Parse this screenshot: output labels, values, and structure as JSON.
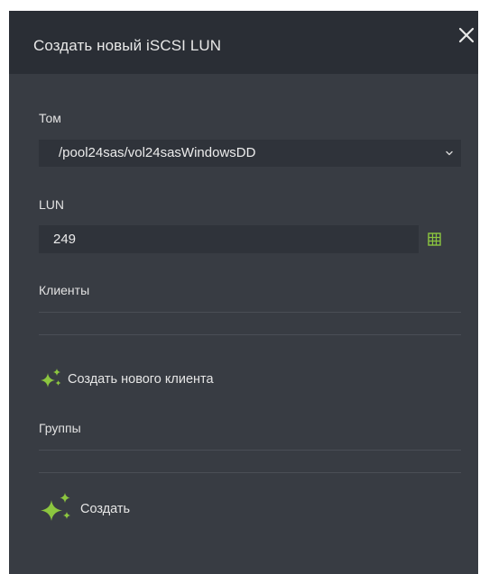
{
  "dialog": {
    "title": "Создать новый iSCSI LUN",
    "close_icon": "close-icon"
  },
  "form": {
    "volume": {
      "label": "Том",
      "value": "/pool24sas/vol24sasWindowsDD"
    },
    "lun": {
      "label": "LUN",
      "value": "249",
      "picker_icon": "grid-icon"
    },
    "clients": {
      "label": "Клиенты",
      "value": ""
    },
    "create_client": {
      "label": "Создать нового клиента",
      "icon": "sparkle-icon"
    },
    "groups": {
      "label": "Группы",
      "value": ""
    },
    "create": {
      "label": "Создать",
      "icon": "sparkle-icon"
    }
  },
  "colors": {
    "accent": "#8cc63f",
    "header_bg": "#2a2e35",
    "body_bg": "#383c43",
    "field_bg": "#2f333a"
  }
}
